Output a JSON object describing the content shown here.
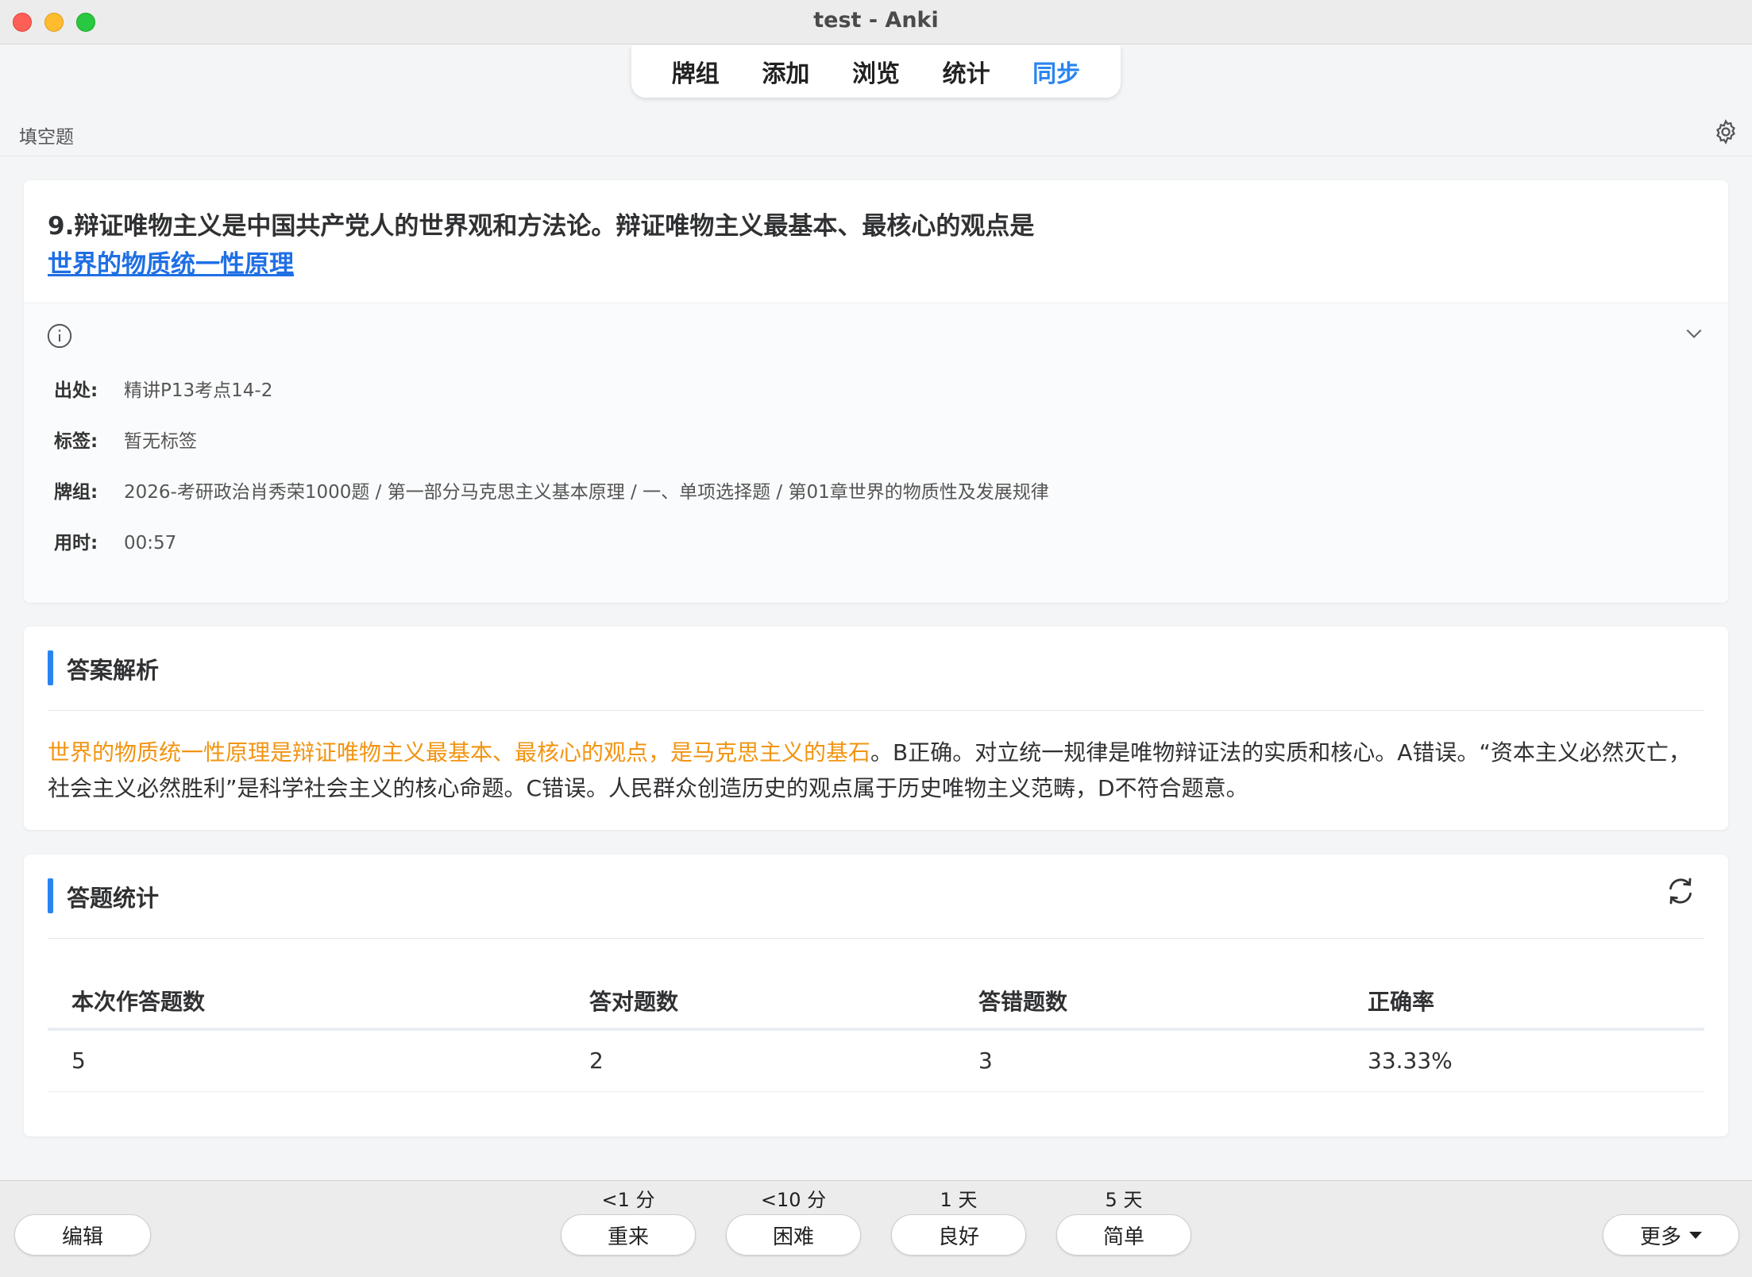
{
  "window": {
    "title": "test - Anki"
  },
  "toolbar": {
    "items": [
      "牌组",
      "添加",
      "浏览",
      "统计",
      "同步"
    ],
    "active_index": 4
  },
  "header": {
    "breadcrumb": "填空题"
  },
  "question": {
    "text": "9.辩证唯物主义是中国共产党人的世界观和方法论。辩证唯物主义最基本、最核心的观点是",
    "answer": "世界的物质统一性原理"
  },
  "meta": {
    "source_label": "出处:",
    "source_value": "精讲P13考点14-2",
    "tags_label": "标签:",
    "tags_value": "暂无标签",
    "deck_label": "牌组:",
    "deck_value": "2026-考研政治肖秀荣1000题 / 第一部分马克思主义基本原理 / 一、单项选择题 / 第01章世界的物质性及发展规律",
    "time_label": "用时:",
    "time_value": "00:57"
  },
  "analysis": {
    "title": "答案解析",
    "highlight": "世界的物质统一性原理是辩证唯物主义最基本、最核心的观点，是马克思主义的基石",
    "rest": "。B正确。对立统一规律是唯物辩证法的实质和核心。A错误。“资本主义必然灭亡，社会主义必然胜利”是科学社会主义的核心命题。C错误。人民群众创造历史的观点属于历史唯物主义范畴，D不符合题意。"
  },
  "stats": {
    "title": "答题统计",
    "headers": [
      "本次作答题数",
      "答对题数",
      "答错题数",
      "正确率"
    ],
    "row": [
      "5",
      "2",
      "3",
      "33.33%"
    ]
  },
  "bottom": {
    "edit_label": "编辑",
    "more_label": "更多",
    "answers": [
      {
        "interval": "<1 分",
        "label": "重来"
      },
      {
        "interval": "<10 分",
        "label": "困难"
      },
      {
        "interval": "1 天",
        "label": "良好"
      },
      {
        "interval": "5 天",
        "label": "简单"
      }
    ]
  },
  "colors": {
    "accent": "#2a84f0",
    "highlight": "#f29411",
    "answer_link": "#1f6fe5"
  }
}
